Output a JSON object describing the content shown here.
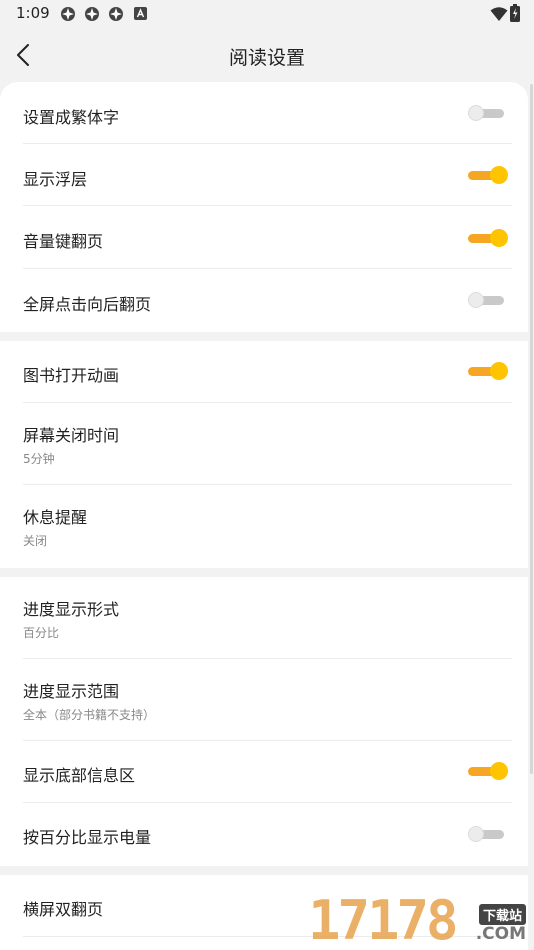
{
  "status_bar": {
    "time": "1:09"
  },
  "header": {
    "title": "阅读设置"
  },
  "sections": [
    {
      "items": [
        {
          "label": "设置成繁体字",
          "toggle": false
        },
        {
          "label": "显示浮层",
          "toggle": true
        },
        {
          "label": "音量键翻页",
          "toggle": true
        },
        {
          "label": "全屏点击向后翻页",
          "toggle": false
        }
      ]
    },
    {
      "items": [
        {
          "label": "图书打开动画",
          "toggle": true
        },
        {
          "label": "屏幕关闭时间",
          "value": "5分钟"
        },
        {
          "label": "休息提醒",
          "value": "关闭"
        }
      ]
    },
    {
      "items": [
        {
          "label": "进度显示形式",
          "value": "百分比"
        },
        {
          "label": "进度显示范围",
          "value": "全本（部分书籍不支持）"
        },
        {
          "label": "显示底部信息区",
          "toggle": true
        },
        {
          "label": "按百分比显示电量",
          "toggle": false
        }
      ]
    },
    {
      "items": [
        {
          "label": "横屏双翻页"
        }
      ]
    }
  ],
  "watermark": {
    "number": "17178",
    "tag": "下载站",
    "domain": ".COM"
  },
  "colors": {
    "accent": "#ffc400",
    "accent_track": "#f5a623",
    "off_track": "#c9c9c9",
    "background": "#f2f2f2"
  }
}
